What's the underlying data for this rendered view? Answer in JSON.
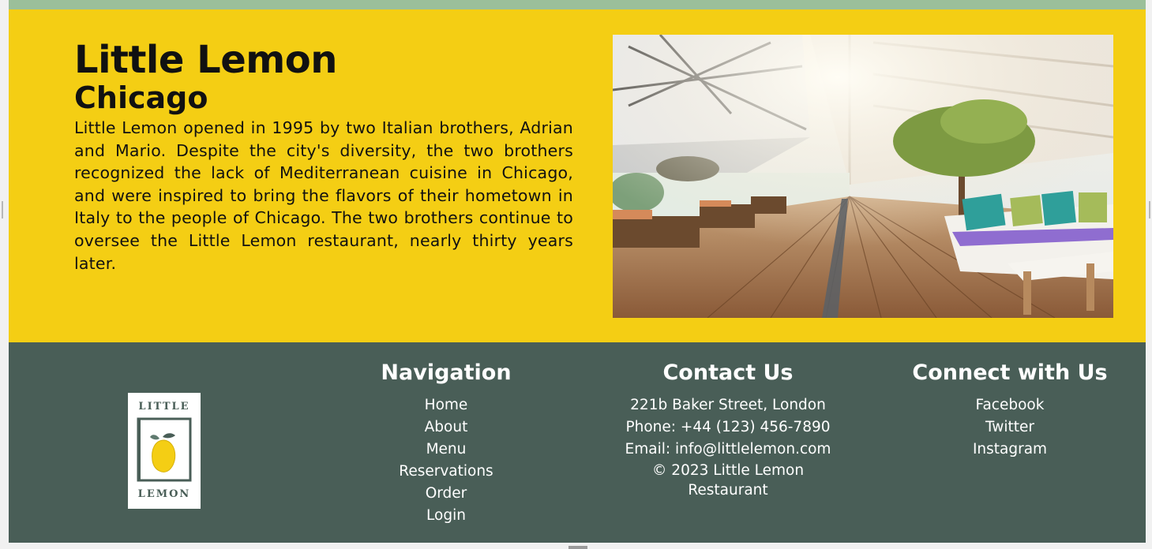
{
  "hero": {
    "title": "Little Lemon",
    "subtitle": "Chicago",
    "description": "Little Lemon opened in 1995 by two Italian brothers, Adrian and Mario. Despite the city's diversity, the two brothers recognized the lack of Mediterranean cuisine in Chicago, and were inspired to bring the flavors of their hometown in Italy to the people of Chicago. The two brothers continue to oversee the Little Lemon restaurant, nearly thirty years later.",
    "image": "restaurant-terrace-photo"
  },
  "footer": {
    "logo": {
      "top_text": "LITTLE",
      "bottom_text": "LEMON",
      "icon": "lemon-icon"
    },
    "navigation": {
      "heading": "Navigation",
      "items": [
        "Home",
        "About",
        "Menu",
        "Reservations",
        "Order",
        "Login"
      ]
    },
    "contact": {
      "heading": "Contact Us",
      "address": "221b Baker Street, London",
      "phone": "Phone: +44 (123) 456-7890",
      "email": "Email: info@littlelemon.com",
      "copyright": "© 2023 Little Lemon Restaurant"
    },
    "social": {
      "heading": "Connect with Us",
      "items": [
        "Facebook",
        "Twitter",
        "Instagram"
      ]
    }
  },
  "colors": {
    "top_bar": "#9bbf9a",
    "hero_background": "#f4ce14",
    "footer_background": "#495e57",
    "text_dark": "#111111",
    "text_light": "#ffffff"
  }
}
